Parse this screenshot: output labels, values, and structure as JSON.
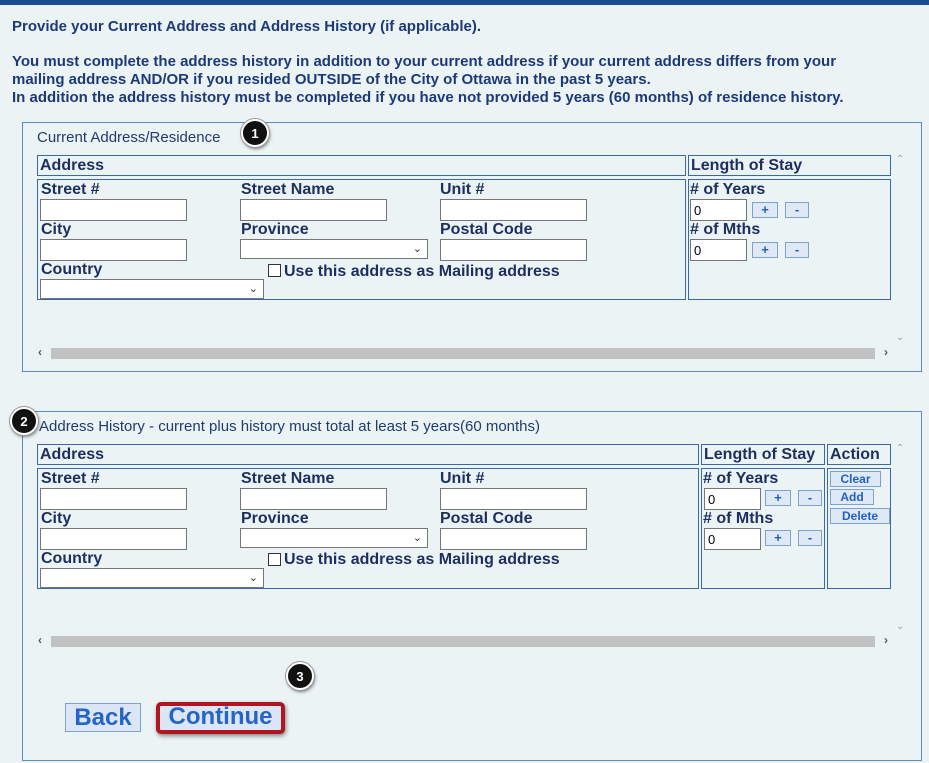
{
  "intro": {
    "line1": "Provide your Current Address and Address History (if applicable).",
    "line2": "You must complete the address history in addition to your current address if your current address differs from your",
    "line3": "mailing address AND/OR if you resided OUTSIDE of the City of Ottawa in the past 5 years.",
    "line4": "In addition the address history must be completed if you have not provided 5 years (60 months) of residence history."
  },
  "markers": {
    "m1": "1",
    "m2": "2",
    "m3": "3"
  },
  "current": {
    "legend": "Current Address/Residence",
    "header_address": "Address",
    "header_length": "Length of Stay",
    "street_num_label": "Street #",
    "street_name_label": "Street Name",
    "unit_label": "Unit #",
    "city_label": "City",
    "province_label": "Province",
    "postal_label": "Postal Code",
    "country_label": "Country",
    "mailing_label": "Use this address as Mailing address",
    "years_label": "# of Years",
    "months_label": "# of Mths",
    "years_value": "0",
    "months_value": "0",
    "plus": "+",
    "minus": "-"
  },
  "history": {
    "legend": "Address History - current plus history must total at least 5 years(60 months)",
    "header_address": "Address",
    "header_length": "Length of Stay",
    "header_action": "Action",
    "street_num_label": "Street #",
    "street_name_label": "Street Name",
    "unit_label": "Unit #",
    "city_label": "City",
    "province_label": "Province",
    "postal_label": "Postal Code",
    "country_label": "Country",
    "mailing_label": "Use this address as Mailing address",
    "years_label": "# of Years",
    "months_label": "# of Mths",
    "years_value": "0",
    "months_value": "0",
    "plus": "+",
    "minus": "-",
    "clear_label": "Clear",
    "add_label": "Add",
    "delete_label": "Delete"
  },
  "nav": {
    "back_label": "Back",
    "continue_label": "Continue"
  },
  "icons": {
    "up": "chevron-up-icon",
    "down": "chevron-down-icon",
    "left": "chevron-left-icon",
    "right": "chevron-right-icon"
  },
  "colors": {
    "accent": "#1f4b8f",
    "highlight": "#b01622",
    "button_text": "#2665c7"
  }
}
